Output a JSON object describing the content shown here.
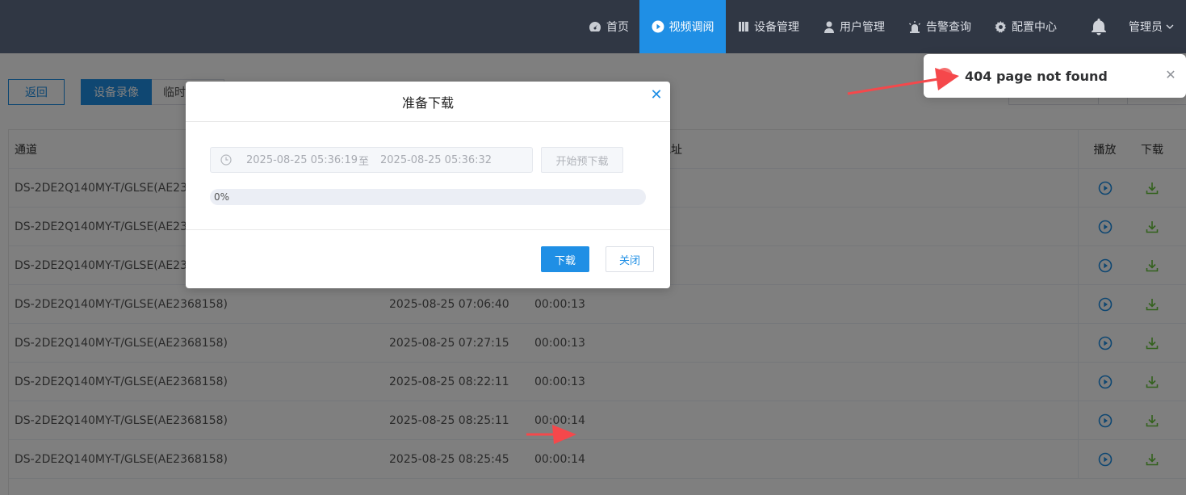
{
  "nav": {
    "items": [
      {
        "label": "首页",
        "icon": "dashboard-icon"
      },
      {
        "label": "视频调阅",
        "icon": "play-circle-icon",
        "active": true
      },
      {
        "label": "设备管理",
        "icon": "book-icon"
      },
      {
        "label": "用户管理",
        "icon": "user-icon"
      },
      {
        "label": "告警查询",
        "icon": "alarm-light-icon"
      },
      {
        "label": "配置中心",
        "icon": "gear-icon"
      }
    ],
    "user": "管理员"
  },
  "toolbar": {
    "back_label": "返回",
    "tab_device": "设备录像",
    "tab_temp": "临时"
  },
  "table": {
    "headers": {
      "channel": "通道",
      "address": "地址",
      "play": "播放",
      "download": "下载"
    },
    "rows": [
      {
        "channel": "DS-2DE2Q140MY-T/GLSE(AE236",
        "time": "",
        "duration": ""
      },
      {
        "channel": "DS-2DE2Q140MY-T/GLSE(AE236",
        "time": "",
        "duration": ""
      },
      {
        "channel": "DS-2DE2Q140MY-T/GLSE(AE236",
        "time": "",
        "duration": ""
      },
      {
        "channel": "DS-2DE2Q140MY-T/GLSE(AE2368158)",
        "time": "2025-08-25 07:06:40",
        "duration": "00:00:13"
      },
      {
        "channel": "DS-2DE2Q140MY-T/GLSE(AE2368158)",
        "time": "2025-08-25 07:27:15",
        "duration": "00:00:13"
      },
      {
        "channel": "DS-2DE2Q140MY-T/GLSE(AE2368158)",
        "time": "2025-08-25 08:22:11",
        "duration": "00:00:13"
      },
      {
        "channel": "DS-2DE2Q140MY-T/GLSE(AE2368158)",
        "time": "2025-08-25 08:25:11",
        "duration": "00:00:14"
      },
      {
        "channel": "DS-2DE2Q140MY-T/GLSE(AE2368158)",
        "time": "2025-08-25 08:25:45",
        "duration": "00:00:14"
      }
    ]
  },
  "modal": {
    "title": "准备下载",
    "start_time": "2025-08-25 05:36:19",
    "range_separator": "至",
    "end_time": "2025-08-25 05:36:32",
    "pre_download_label": "开始预下载",
    "progress_percent": 0,
    "progress_text": "0%",
    "download_label": "下载",
    "close_label": "关闭"
  },
  "toast": {
    "message": "404 page not found"
  },
  "colors": {
    "nav_bg": "#303744",
    "accent": "#1f8fe5",
    "download_green": "#67c23a",
    "error_red": "#f56c6c",
    "annotation_arrow": "#f5484b"
  }
}
